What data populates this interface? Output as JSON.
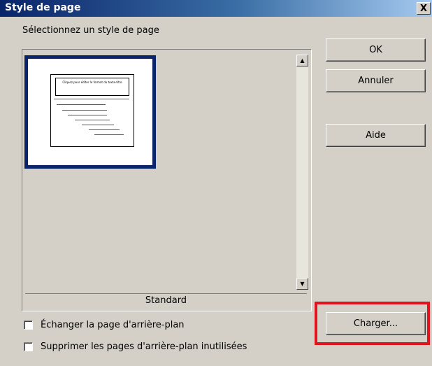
{
  "dialog": {
    "title": "Style de page",
    "close_glyph": "X"
  },
  "list": {
    "label": "Sélectionnez un style de page",
    "selected_style": "Standard",
    "thumbnail_title": "Cliquez pour éditer le format du texte-titre"
  },
  "options": {
    "exchange_background": {
      "label": "Échanger la page d'arrière-plan",
      "checked": false
    },
    "delete_unused": {
      "label": "Supprimer les pages d'arrière-plan inutilisées",
      "checked": false
    }
  },
  "buttons": {
    "ok": "OK",
    "cancel": "Annuler",
    "help": "Aide",
    "load": "Charger..."
  },
  "icons": {
    "scroll_up": "triangle-up",
    "scroll_down": "triangle-down",
    "close": "close-x"
  },
  "colors": {
    "highlight": "#e0141e",
    "selection": "#0a246a"
  }
}
